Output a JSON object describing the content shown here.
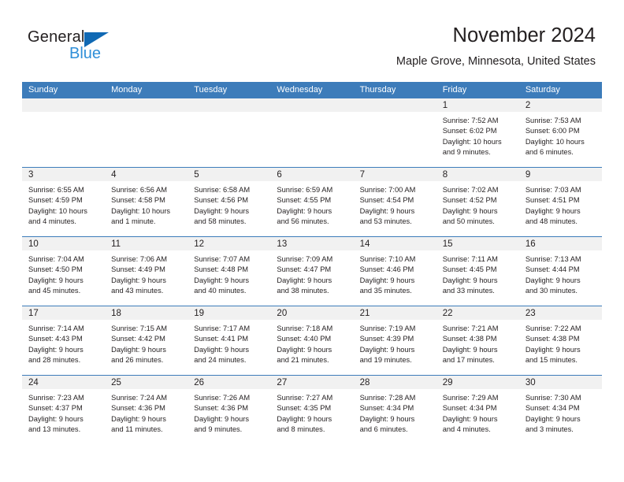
{
  "brand": {
    "name_top": "General",
    "name_bottom": "Blue",
    "accent_blue": "#1069b4",
    "light_blue": "#2f8fd8"
  },
  "header": {
    "title": "November 2024",
    "subtitle": "Maple Grove, Minnesota, United States"
  },
  "calendar": {
    "header_bg": "#3d7cba",
    "day_band_bg": "#f1f1f1",
    "weekdays": [
      "Sunday",
      "Monday",
      "Tuesday",
      "Wednesday",
      "Thursday",
      "Friday",
      "Saturday"
    ],
    "weeks": [
      [
        {
          "day": "",
          "sunrise": "",
          "sunset": "",
          "daylight_line1": "",
          "daylight_line2": ""
        },
        {
          "day": "",
          "sunrise": "",
          "sunset": "",
          "daylight_line1": "",
          "daylight_line2": ""
        },
        {
          "day": "",
          "sunrise": "",
          "sunset": "",
          "daylight_line1": "",
          "daylight_line2": ""
        },
        {
          "day": "",
          "sunrise": "",
          "sunset": "",
          "daylight_line1": "",
          "daylight_line2": ""
        },
        {
          "day": "",
          "sunrise": "",
          "sunset": "",
          "daylight_line1": "",
          "daylight_line2": ""
        },
        {
          "day": "1",
          "sunrise": "Sunrise: 7:52 AM",
          "sunset": "Sunset: 6:02 PM",
          "daylight_line1": "Daylight: 10 hours",
          "daylight_line2": "and 9 minutes."
        },
        {
          "day": "2",
          "sunrise": "Sunrise: 7:53 AM",
          "sunset": "Sunset: 6:00 PM",
          "daylight_line1": "Daylight: 10 hours",
          "daylight_line2": "and 6 minutes."
        }
      ],
      [
        {
          "day": "3",
          "sunrise": "Sunrise: 6:55 AM",
          "sunset": "Sunset: 4:59 PM",
          "daylight_line1": "Daylight: 10 hours",
          "daylight_line2": "and 4 minutes."
        },
        {
          "day": "4",
          "sunrise": "Sunrise: 6:56 AM",
          "sunset": "Sunset: 4:58 PM",
          "daylight_line1": "Daylight: 10 hours",
          "daylight_line2": "and 1 minute."
        },
        {
          "day": "5",
          "sunrise": "Sunrise: 6:58 AM",
          "sunset": "Sunset: 4:56 PM",
          "daylight_line1": "Daylight: 9 hours",
          "daylight_line2": "and 58 minutes."
        },
        {
          "day": "6",
          "sunrise": "Sunrise: 6:59 AM",
          "sunset": "Sunset: 4:55 PM",
          "daylight_line1": "Daylight: 9 hours",
          "daylight_line2": "and 56 minutes."
        },
        {
          "day": "7",
          "sunrise": "Sunrise: 7:00 AM",
          "sunset": "Sunset: 4:54 PM",
          "daylight_line1": "Daylight: 9 hours",
          "daylight_line2": "and 53 minutes."
        },
        {
          "day": "8",
          "sunrise": "Sunrise: 7:02 AM",
          "sunset": "Sunset: 4:52 PM",
          "daylight_line1": "Daylight: 9 hours",
          "daylight_line2": "and 50 minutes."
        },
        {
          "day": "9",
          "sunrise": "Sunrise: 7:03 AM",
          "sunset": "Sunset: 4:51 PM",
          "daylight_line1": "Daylight: 9 hours",
          "daylight_line2": "and 48 minutes."
        }
      ],
      [
        {
          "day": "10",
          "sunrise": "Sunrise: 7:04 AM",
          "sunset": "Sunset: 4:50 PM",
          "daylight_line1": "Daylight: 9 hours",
          "daylight_line2": "and 45 minutes."
        },
        {
          "day": "11",
          "sunrise": "Sunrise: 7:06 AM",
          "sunset": "Sunset: 4:49 PM",
          "daylight_line1": "Daylight: 9 hours",
          "daylight_line2": "and 43 minutes."
        },
        {
          "day": "12",
          "sunrise": "Sunrise: 7:07 AM",
          "sunset": "Sunset: 4:48 PM",
          "daylight_line1": "Daylight: 9 hours",
          "daylight_line2": "and 40 minutes."
        },
        {
          "day": "13",
          "sunrise": "Sunrise: 7:09 AM",
          "sunset": "Sunset: 4:47 PM",
          "daylight_line1": "Daylight: 9 hours",
          "daylight_line2": "and 38 minutes."
        },
        {
          "day": "14",
          "sunrise": "Sunrise: 7:10 AM",
          "sunset": "Sunset: 4:46 PM",
          "daylight_line1": "Daylight: 9 hours",
          "daylight_line2": "and 35 minutes."
        },
        {
          "day": "15",
          "sunrise": "Sunrise: 7:11 AM",
          "sunset": "Sunset: 4:45 PM",
          "daylight_line1": "Daylight: 9 hours",
          "daylight_line2": "and 33 minutes."
        },
        {
          "day": "16",
          "sunrise": "Sunrise: 7:13 AM",
          "sunset": "Sunset: 4:44 PM",
          "daylight_line1": "Daylight: 9 hours",
          "daylight_line2": "and 30 minutes."
        }
      ],
      [
        {
          "day": "17",
          "sunrise": "Sunrise: 7:14 AM",
          "sunset": "Sunset: 4:43 PM",
          "daylight_line1": "Daylight: 9 hours",
          "daylight_line2": "and 28 minutes."
        },
        {
          "day": "18",
          "sunrise": "Sunrise: 7:15 AM",
          "sunset": "Sunset: 4:42 PM",
          "daylight_line1": "Daylight: 9 hours",
          "daylight_line2": "and 26 minutes."
        },
        {
          "day": "19",
          "sunrise": "Sunrise: 7:17 AM",
          "sunset": "Sunset: 4:41 PM",
          "daylight_line1": "Daylight: 9 hours",
          "daylight_line2": "and 24 minutes."
        },
        {
          "day": "20",
          "sunrise": "Sunrise: 7:18 AM",
          "sunset": "Sunset: 4:40 PM",
          "daylight_line1": "Daylight: 9 hours",
          "daylight_line2": "and 21 minutes."
        },
        {
          "day": "21",
          "sunrise": "Sunrise: 7:19 AM",
          "sunset": "Sunset: 4:39 PM",
          "daylight_line1": "Daylight: 9 hours",
          "daylight_line2": "and 19 minutes."
        },
        {
          "day": "22",
          "sunrise": "Sunrise: 7:21 AM",
          "sunset": "Sunset: 4:38 PM",
          "daylight_line1": "Daylight: 9 hours",
          "daylight_line2": "and 17 minutes."
        },
        {
          "day": "23",
          "sunrise": "Sunrise: 7:22 AM",
          "sunset": "Sunset: 4:38 PM",
          "daylight_line1": "Daylight: 9 hours",
          "daylight_line2": "and 15 minutes."
        }
      ],
      [
        {
          "day": "24",
          "sunrise": "Sunrise: 7:23 AM",
          "sunset": "Sunset: 4:37 PM",
          "daylight_line1": "Daylight: 9 hours",
          "daylight_line2": "and 13 minutes."
        },
        {
          "day": "25",
          "sunrise": "Sunrise: 7:24 AM",
          "sunset": "Sunset: 4:36 PM",
          "daylight_line1": "Daylight: 9 hours",
          "daylight_line2": "and 11 minutes."
        },
        {
          "day": "26",
          "sunrise": "Sunrise: 7:26 AM",
          "sunset": "Sunset: 4:36 PM",
          "daylight_line1": "Daylight: 9 hours",
          "daylight_line2": "and 9 minutes."
        },
        {
          "day": "27",
          "sunrise": "Sunrise: 7:27 AM",
          "sunset": "Sunset: 4:35 PM",
          "daylight_line1": "Daylight: 9 hours",
          "daylight_line2": "and 8 minutes."
        },
        {
          "day": "28",
          "sunrise": "Sunrise: 7:28 AM",
          "sunset": "Sunset: 4:34 PM",
          "daylight_line1": "Daylight: 9 hours",
          "daylight_line2": "and 6 minutes."
        },
        {
          "day": "29",
          "sunrise": "Sunrise: 7:29 AM",
          "sunset": "Sunset: 4:34 PM",
          "daylight_line1": "Daylight: 9 hours",
          "daylight_line2": "and 4 minutes."
        },
        {
          "day": "30",
          "sunrise": "Sunrise: 7:30 AM",
          "sunset": "Sunset: 4:34 PM",
          "daylight_line1": "Daylight: 9 hours",
          "daylight_line2": "and 3 minutes."
        }
      ]
    ]
  }
}
